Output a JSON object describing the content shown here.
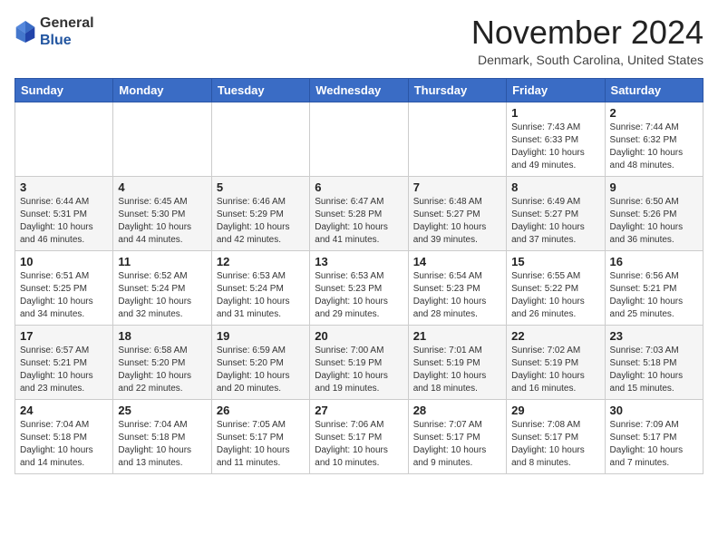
{
  "header": {
    "logo": {
      "line1": "General",
      "line2": "Blue"
    },
    "title": "November 2024",
    "location": "Denmark, South Carolina, United States"
  },
  "weekdays": [
    "Sunday",
    "Monday",
    "Tuesday",
    "Wednesday",
    "Thursday",
    "Friday",
    "Saturday"
  ],
  "weeks": [
    [
      {
        "day": "",
        "info": ""
      },
      {
        "day": "",
        "info": ""
      },
      {
        "day": "",
        "info": ""
      },
      {
        "day": "",
        "info": ""
      },
      {
        "day": "",
        "info": ""
      },
      {
        "day": "1",
        "info": "Sunrise: 7:43 AM\nSunset: 6:33 PM\nDaylight: 10 hours\nand 49 minutes."
      },
      {
        "day": "2",
        "info": "Sunrise: 7:44 AM\nSunset: 6:32 PM\nDaylight: 10 hours\nand 48 minutes."
      }
    ],
    [
      {
        "day": "3",
        "info": "Sunrise: 6:44 AM\nSunset: 5:31 PM\nDaylight: 10 hours\nand 46 minutes."
      },
      {
        "day": "4",
        "info": "Sunrise: 6:45 AM\nSunset: 5:30 PM\nDaylight: 10 hours\nand 44 minutes."
      },
      {
        "day": "5",
        "info": "Sunrise: 6:46 AM\nSunset: 5:29 PM\nDaylight: 10 hours\nand 42 minutes."
      },
      {
        "day": "6",
        "info": "Sunrise: 6:47 AM\nSunset: 5:28 PM\nDaylight: 10 hours\nand 41 minutes."
      },
      {
        "day": "7",
        "info": "Sunrise: 6:48 AM\nSunset: 5:27 PM\nDaylight: 10 hours\nand 39 minutes."
      },
      {
        "day": "8",
        "info": "Sunrise: 6:49 AM\nSunset: 5:27 PM\nDaylight: 10 hours\nand 37 minutes."
      },
      {
        "day": "9",
        "info": "Sunrise: 6:50 AM\nSunset: 5:26 PM\nDaylight: 10 hours\nand 36 minutes."
      }
    ],
    [
      {
        "day": "10",
        "info": "Sunrise: 6:51 AM\nSunset: 5:25 PM\nDaylight: 10 hours\nand 34 minutes."
      },
      {
        "day": "11",
        "info": "Sunrise: 6:52 AM\nSunset: 5:24 PM\nDaylight: 10 hours\nand 32 minutes."
      },
      {
        "day": "12",
        "info": "Sunrise: 6:53 AM\nSunset: 5:24 PM\nDaylight: 10 hours\nand 31 minutes."
      },
      {
        "day": "13",
        "info": "Sunrise: 6:53 AM\nSunset: 5:23 PM\nDaylight: 10 hours\nand 29 minutes."
      },
      {
        "day": "14",
        "info": "Sunrise: 6:54 AM\nSunset: 5:23 PM\nDaylight: 10 hours\nand 28 minutes."
      },
      {
        "day": "15",
        "info": "Sunrise: 6:55 AM\nSunset: 5:22 PM\nDaylight: 10 hours\nand 26 minutes."
      },
      {
        "day": "16",
        "info": "Sunrise: 6:56 AM\nSunset: 5:21 PM\nDaylight: 10 hours\nand 25 minutes."
      }
    ],
    [
      {
        "day": "17",
        "info": "Sunrise: 6:57 AM\nSunset: 5:21 PM\nDaylight: 10 hours\nand 23 minutes."
      },
      {
        "day": "18",
        "info": "Sunrise: 6:58 AM\nSunset: 5:20 PM\nDaylight: 10 hours\nand 22 minutes."
      },
      {
        "day": "19",
        "info": "Sunrise: 6:59 AM\nSunset: 5:20 PM\nDaylight: 10 hours\nand 20 minutes."
      },
      {
        "day": "20",
        "info": "Sunrise: 7:00 AM\nSunset: 5:19 PM\nDaylight: 10 hours\nand 19 minutes."
      },
      {
        "day": "21",
        "info": "Sunrise: 7:01 AM\nSunset: 5:19 PM\nDaylight: 10 hours\nand 18 minutes."
      },
      {
        "day": "22",
        "info": "Sunrise: 7:02 AM\nSunset: 5:19 PM\nDaylight: 10 hours\nand 16 minutes."
      },
      {
        "day": "23",
        "info": "Sunrise: 7:03 AM\nSunset: 5:18 PM\nDaylight: 10 hours\nand 15 minutes."
      }
    ],
    [
      {
        "day": "24",
        "info": "Sunrise: 7:04 AM\nSunset: 5:18 PM\nDaylight: 10 hours\nand 14 minutes."
      },
      {
        "day": "25",
        "info": "Sunrise: 7:04 AM\nSunset: 5:18 PM\nDaylight: 10 hours\nand 13 minutes."
      },
      {
        "day": "26",
        "info": "Sunrise: 7:05 AM\nSunset: 5:17 PM\nDaylight: 10 hours\nand 11 minutes."
      },
      {
        "day": "27",
        "info": "Sunrise: 7:06 AM\nSunset: 5:17 PM\nDaylight: 10 hours\nand 10 minutes."
      },
      {
        "day": "28",
        "info": "Sunrise: 7:07 AM\nSunset: 5:17 PM\nDaylight: 10 hours\nand 9 minutes."
      },
      {
        "day": "29",
        "info": "Sunrise: 7:08 AM\nSunset: 5:17 PM\nDaylight: 10 hours\nand 8 minutes."
      },
      {
        "day": "30",
        "info": "Sunrise: 7:09 AM\nSunset: 5:17 PM\nDaylight: 10 hours\nand 7 minutes."
      }
    ]
  ]
}
